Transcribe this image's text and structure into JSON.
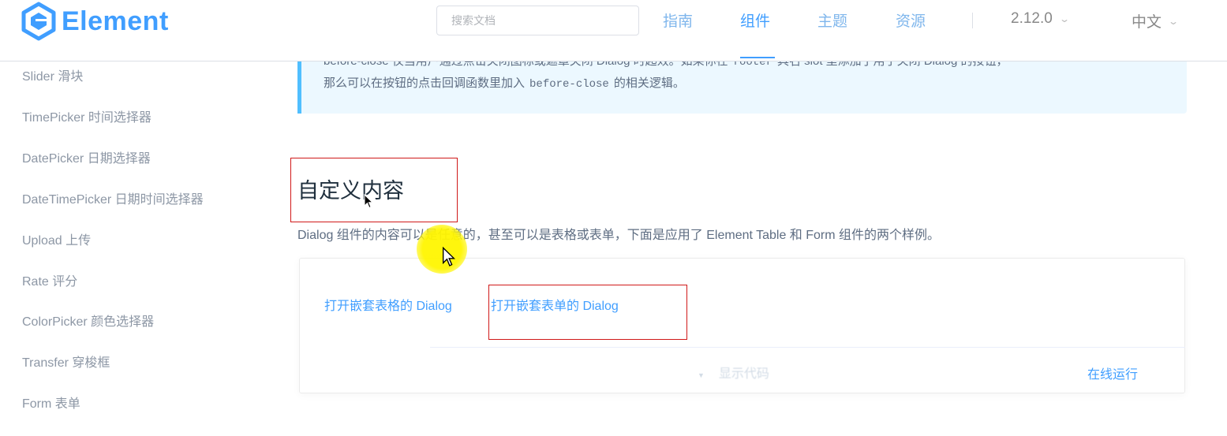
{
  "header": {
    "logo_text": "Element",
    "search_placeholder": "搜索文档",
    "nav": [
      "指南",
      "组件",
      "主题",
      "资源"
    ],
    "active_nav": "组件",
    "version": "2.12.0",
    "language": "中文"
  },
  "sidebar": {
    "items": [
      "Slider 滑块",
      "TimePicker 时间选择器",
      "DatePicker 日期选择器",
      "DateTimePicker 日期时间选择器",
      "Upload 上传",
      "Rate 评分",
      "ColorPicker 颜色选择器",
      "Transfer 穿梭框",
      "Form 表单"
    ]
  },
  "tip": {
    "line1_prefix": "before-close 仅当用户通过点击关闭图标或遮罩关闭 Dialog 时起效。如果你在",
    "line1_code": "footer",
    "line1_suffix": "具名 slot 里添加了用于关闭 Dialog 的按钮，",
    "line2_prefix": "那么可以在按钮的点击回调函数里加入",
    "line2_code": "before-close",
    "line2_suffix": "的相关逻辑。"
  },
  "section": {
    "title": "自定义内容",
    "description": "Dialog 组件的内容可以是任意的，甚至可以是表格或表单，下面是应用了 Element Table 和 Form 组件的两个样例。"
  },
  "demo": {
    "table_link": "打开嵌套表格的 Dialog",
    "form_link": "打开嵌套表单的 Dialog",
    "show_code": "显示代码",
    "run_online": "在线运行"
  },
  "colors": {
    "primary": "#409eff",
    "annotation": "#d01919",
    "highlight": "#fff500"
  },
  "icons": [
    "element-logo-icon",
    "chevron-down-icon",
    "caret-down-icon",
    "mouse-cursor-icon"
  ]
}
